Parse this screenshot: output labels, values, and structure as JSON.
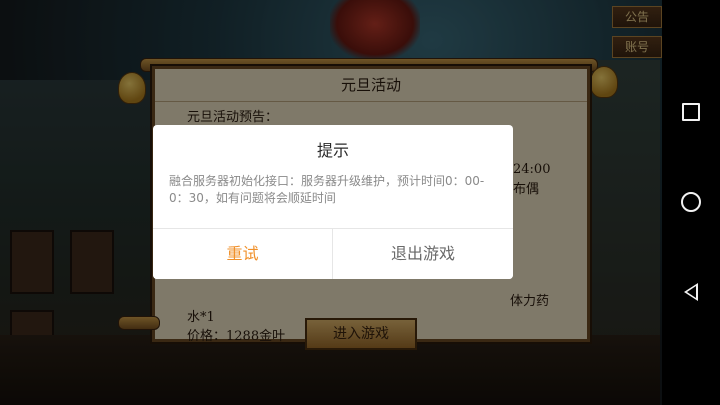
{
  "game": {
    "top_buttons": [
      "公告",
      "账号"
    ],
    "panel": {
      "title": "元旦活动",
      "lines": [
        "元旦活动预告：",
        "水*1",
        "价格：1288金叶"
      ],
      "right_fragments": [
        "24:00",
        "布偶",
        "体力药"
      ]
    },
    "enter_button": "进入游戏"
  },
  "dialog": {
    "title": "提示",
    "message": "融合服务器初始化接口：服务器升级维护，预计时间0：00-0：30，如有问题将会顺延时间",
    "retry_label": "重试",
    "exit_label": "退出游戏",
    "retry_color": "#f0902a"
  },
  "navbar": {
    "icons": [
      "recent-apps-icon",
      "home-icon",
      "back-icon"
    ]
  }
}
